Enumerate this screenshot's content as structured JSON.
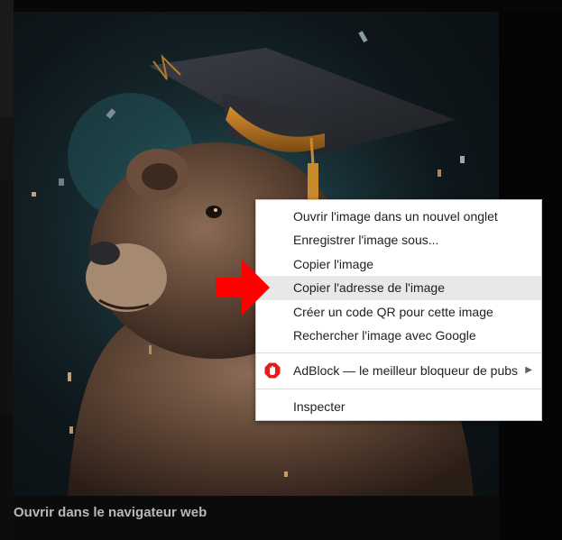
{
  "caption": "Ouvrir dans le navigateur web",
  "context_menu": {
    "items": [
      {
        "label": "Ouvrir l'image dans un nouvel onglet"
      },
      {
        "label": "Enregistrer l'image sous..."
      },
      {
        "label": "Copier l'image"
      },
      {
        "label": "Copier l'adresse de l'image",
        "highlighted": true
      },
      {
        "label": "Créer un code QR pour cette image"
      },
      {
        "label": "Rechercher l'image avec Google"
      }
    ],
    "extension_item": {
      "label": "AdBlock — le meilleur bloqueur de pubs",
      "icon": "adblock-icon",
      "has_submenu": true
    },
    "inspect_item": {
      "label": "Inspecter"
    }
  },
  "colors": {
    "menu_background": "#ffffff",
    "menu_highlight": "#e8e8e9",
    "arrow": "#ff0000",
    "adblock_red": "#e31b1b"
  }
}
